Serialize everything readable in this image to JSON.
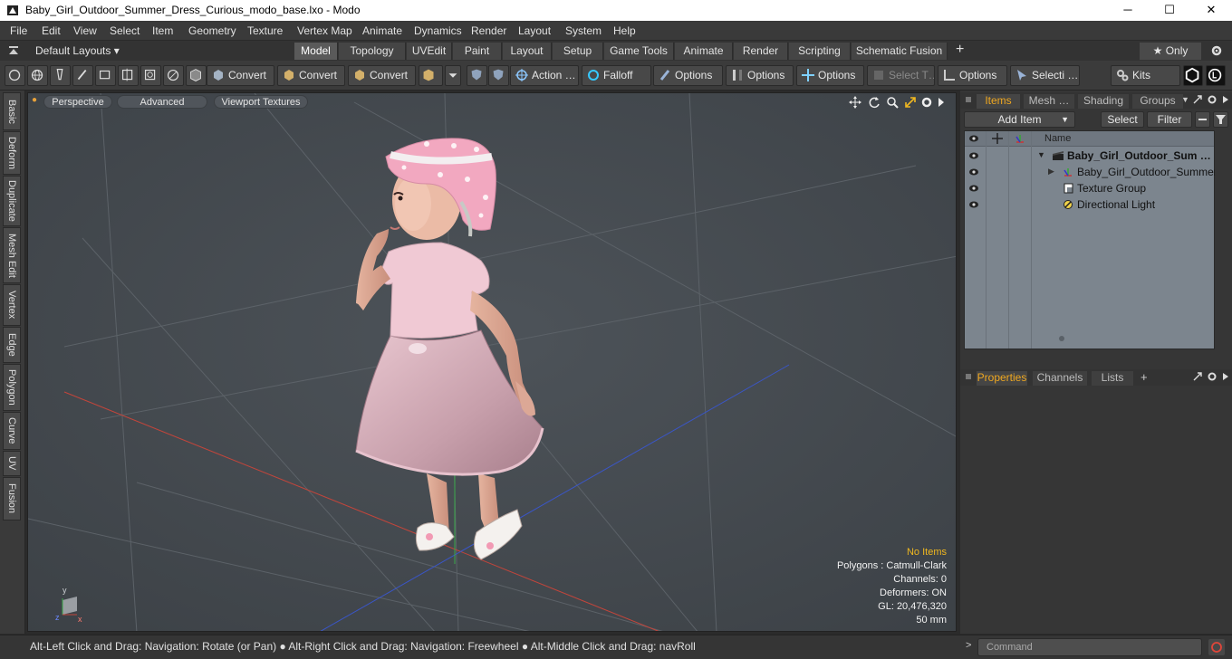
{
  "window": {
    "title": "Baby_Girl_Outdoor_Summer_Dress_Curious_modo_base.lxo - Modo",
    "minimize": "─",
    "maximize": "☐",
    "close": "✕"
  },
  "menu": [
    "File",
    "Edit",
    "View",
    "Select",
    "Item",
    "Geometry",
    "Texture",
    "Vertex Map",
    "Animate",
    "Dynamics",
    "Render",
    "Layout",
    "System",
    "Help"
  ],
  "layouts": {
    "label": "Default Layouts ▾"
  },
  "tabs": [
    "Model",
    "Topology",
    "UVEdit",
    "Paint",
    "Layout",
    "Setup",
    "Game Tools",
    "Animate",
    "Render",
    "Scripting",
    "Schematic Fusion"
  ],
  "tabs_plus": "+",
  "only_button": "★  Only",
  "toolbar": {
    "convert1": "Convert",
    "convert2": "Convert",
    "convert3": "Convert",
    "action": "Action  …",
    "falloff": "Falloff",
    "options1": "Options",
    "options2": "Options",
    "options3": "Options",
    "select_t": "Select T…",
    "options4": "Options",
    "selecti": "Selecti …",
    "kits": "Kits"
  },
  "left_tabs": [
    "Basic",
    "Deform",
    "Duplicate",
    "Mesh Edit",
    "Vertex",
    "Edge",
    "Polygon",
    "Curve",
    "UV",
    "Fusion"
  ],
  "viewport": {
    "view_mode": "Perspective",
    "advanced": "Advanced",
    "textures": "Viewport Textures",
    "stats": {
      "no_items": "No Items",
      "polygons": "Polygons : Catmull-Clark",
      "channels": "Channels: 0",
      "deformers": "Deformers: ON",
      "gl": "GL: 20,476,320",
      "mm": "50 mm"
    }
  },
  "items_panel": {
    "tabs": [
      "Items",
      "Mesh …",
      "Shading",
      "Groups"
    ],
    "add_item": "Add Item",
    "select": "Select",
    "filter": "Filter",
    "col_name": "Name",
    "rows": [
      "Baby_Girl_Outdoor_Sum  …",
      "Baby_Girl_Outdoor_Summer …",
      "Texture Group",
      "Directional Light"
    ]
  },
  "props_panel": {
    "tabs": [
      "Properties",
      "Channels",
      "Lists"
    ],
    "plus": "+"
  },
  "status": {
    "hint": "Alt-Left Click and Drag: Navigation: Rotate (or Pan) ● Alt-Right Click and Drag: Navigation: Freewheel ● Alt-Middle Click and Drag: navRoll",
    "command_placeholder": "Command"
  },
  "colors": {
    "accent": "#f0a820",
    "viewport_bg": "#474c52",
    "list_bg": "#7c858e"
  }
}
